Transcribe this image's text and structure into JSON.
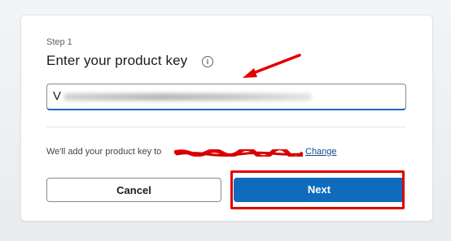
{
  "step_label": "Step 1",
  "title": "Enter your product key",
  "info_icon": "info-icon",
  "key_input": {
    "value_visible": "V"
  },
  "note": {
    "prefix": "We'll add your product key to",
    "link": "Change"
  },
  "buttons": {
    "cancel": "Cancel",
    "next": "Next"
  },
  "colors": {
    "accent": "#0f6cbd",
    "annotation_red": "#e00000"
  }
}
